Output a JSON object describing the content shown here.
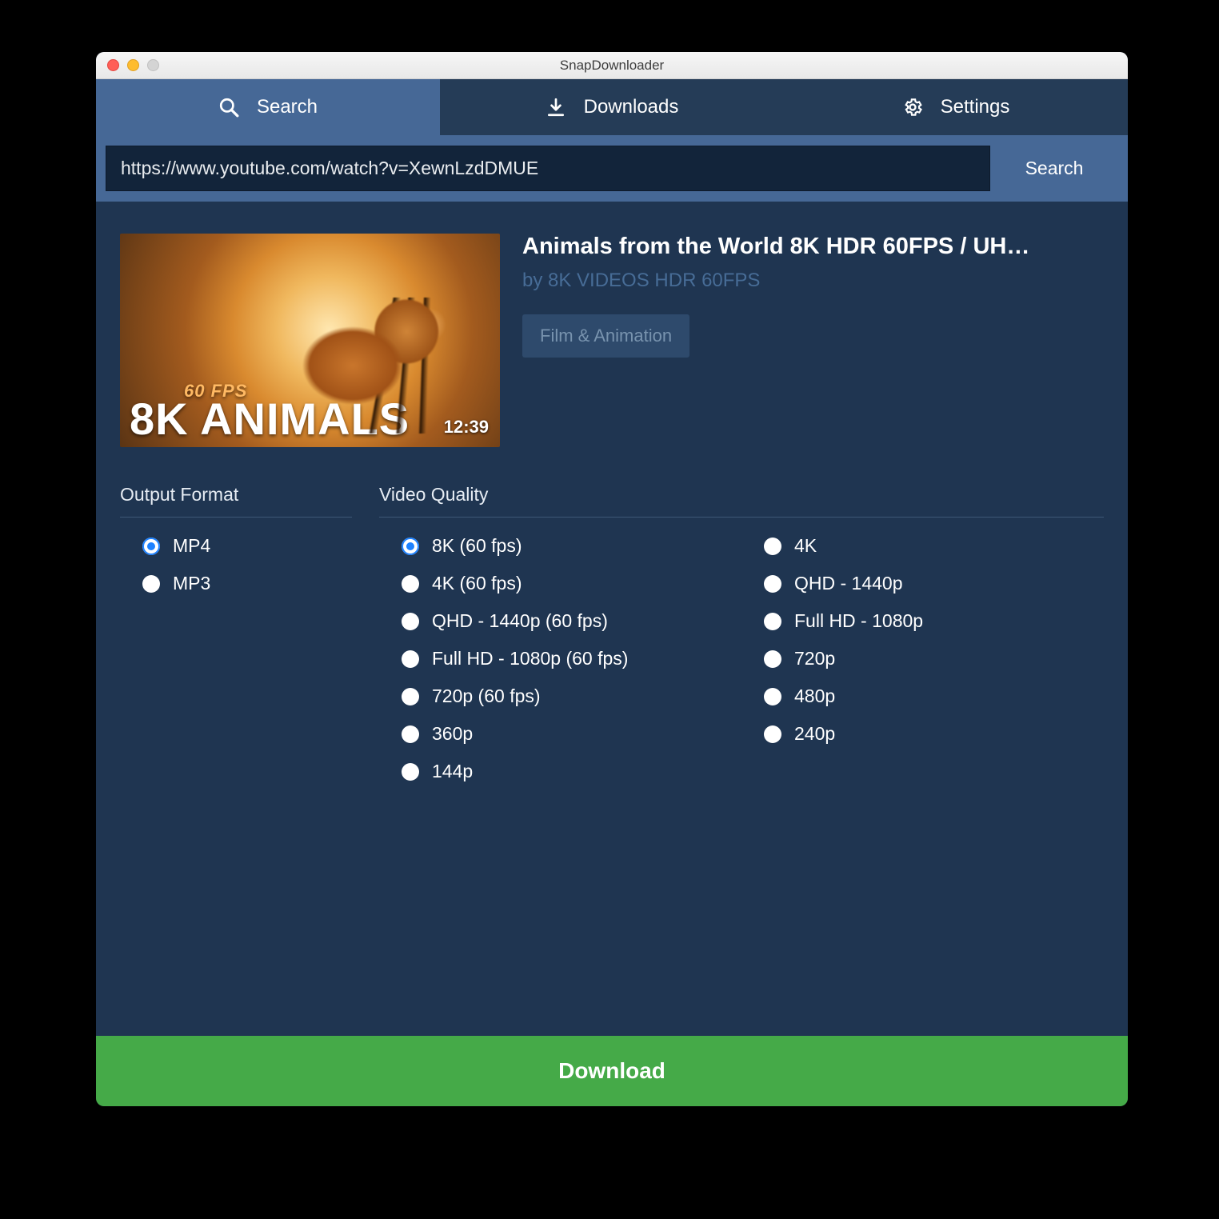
{
  "window": {
    "title": "SnapDownloader"
  },
  "tabs": {
    "search": "Search",
    "downloads": "Downloads",
    "settings": "Settings"
  },
  "search": {
    "url_value": "https://www.youtube.com/watch?v=XewnLzdDMUE",
    "button_label": "Search"
  },
  "video": {
    "title": "Animals from the World 8K HDR 60FPS / UH…",
    "by_prefix": "by ",
    "author": "8K VIDEOS HDR 60FPS",
    "category": "Film & Animation",
    "duration": "12:39",
    "thumb_overlay_fps": "60 FPS",
    "thumb_overlay_big": "8K ANIMALS"
  },
  "sections": {
    "output_format": "Output Format",
    "video_quality": "Video Quality"
  },
  "output_formats": {
    "mp4": "MP4",
    "mp3": "MP3",
    "selected": "mp4"
  },
  "video_quality": {
    "selected": "8k60",
    "col1": [
      {
        "id": "8k60",
        "label": "8K (60 fps)"
      },
      {
        "id": "4k60",
        "label": "4K (60 fps)"
      },
      {
        "id": "qhd60",
        "label": "QHD - 1440p (60 fps)"
      },
      {
        "id": "fhd60",
        "label": "Full HD - 1080p (60 fps)"
      },
      {
        "id": "72060",
        "label": "720p (60 fps)"
      },
      {
        "id": "360",
        "label": "360p"
      },
      {
        "id": "144",
        "label": "144p"
      }
    ],
    "col2": [
      {
        "id": "4k",
        "label": "4K"
      },
      {
        "id": "qhd",
        "label": "QHD - 1440p"
      },
      {
        "id": "fhd",
        "label": "Full HD - 1080p"
      },
      {
        "id": "720",
        "label": "720p"
      },
      {
        "id": "480",
        "label": "480p"
      },
      {
        "id": "240",
        "label": "240p"
      }
    ]
  },
  "download_button": "Download"
}
